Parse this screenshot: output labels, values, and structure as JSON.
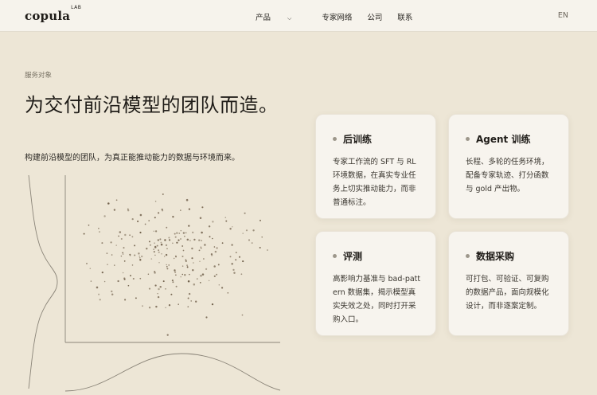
{
  "nav": {
    "logo": "copula",
    "logo_sup": "LAB",
    "items": [
      {
        "label": "产品"
      },
      {
        "label": "专家网络"
      },
      {
        "label": "公司"
      },
      {
        "label": "联系"
      }
    ],
    "lang": "EN"
  },
  "hero": {
    "eyebrow": "服务对象",
    "title": "为交付前沿模型的团队而造。",
    "subtitle": "构建前沿模型的团队，为真正能推动能力的数据与环境而来。"
  },
  "cards": [
    {
      "title": "后训练",
      "body": "专家工作流的 SFT 与 RL 环境数据，在真实专业任务上切实推动能力，而非普通标注。"
    },
    {
      "title": "Agent 训练",
      "body": "长程、多轮的任务环境，配备专家轨迹、打分函数与 gold 产出物。"
    },
    {
      "title": "评测",
      "body": "高影响力基准与 bad-pattern 数据集，揭示模型真实失效之处，同时打开采购入口。"
    },
    {
      "title": "数据采购",
      "body": "可打包、可验证、可复购的数据产品，面向规模化设计，而非逐案定制。"
    }
  ],
  "colors": {
    "background": "#ede6d6",
    "nav_background": "#f6f3ec",
    "card_background": "#f7f4ee",
    "text": "#1f1c18",
    "plot_stroke": "#8a8478",
    "plot_point": "#6b5a45"
  }
}
